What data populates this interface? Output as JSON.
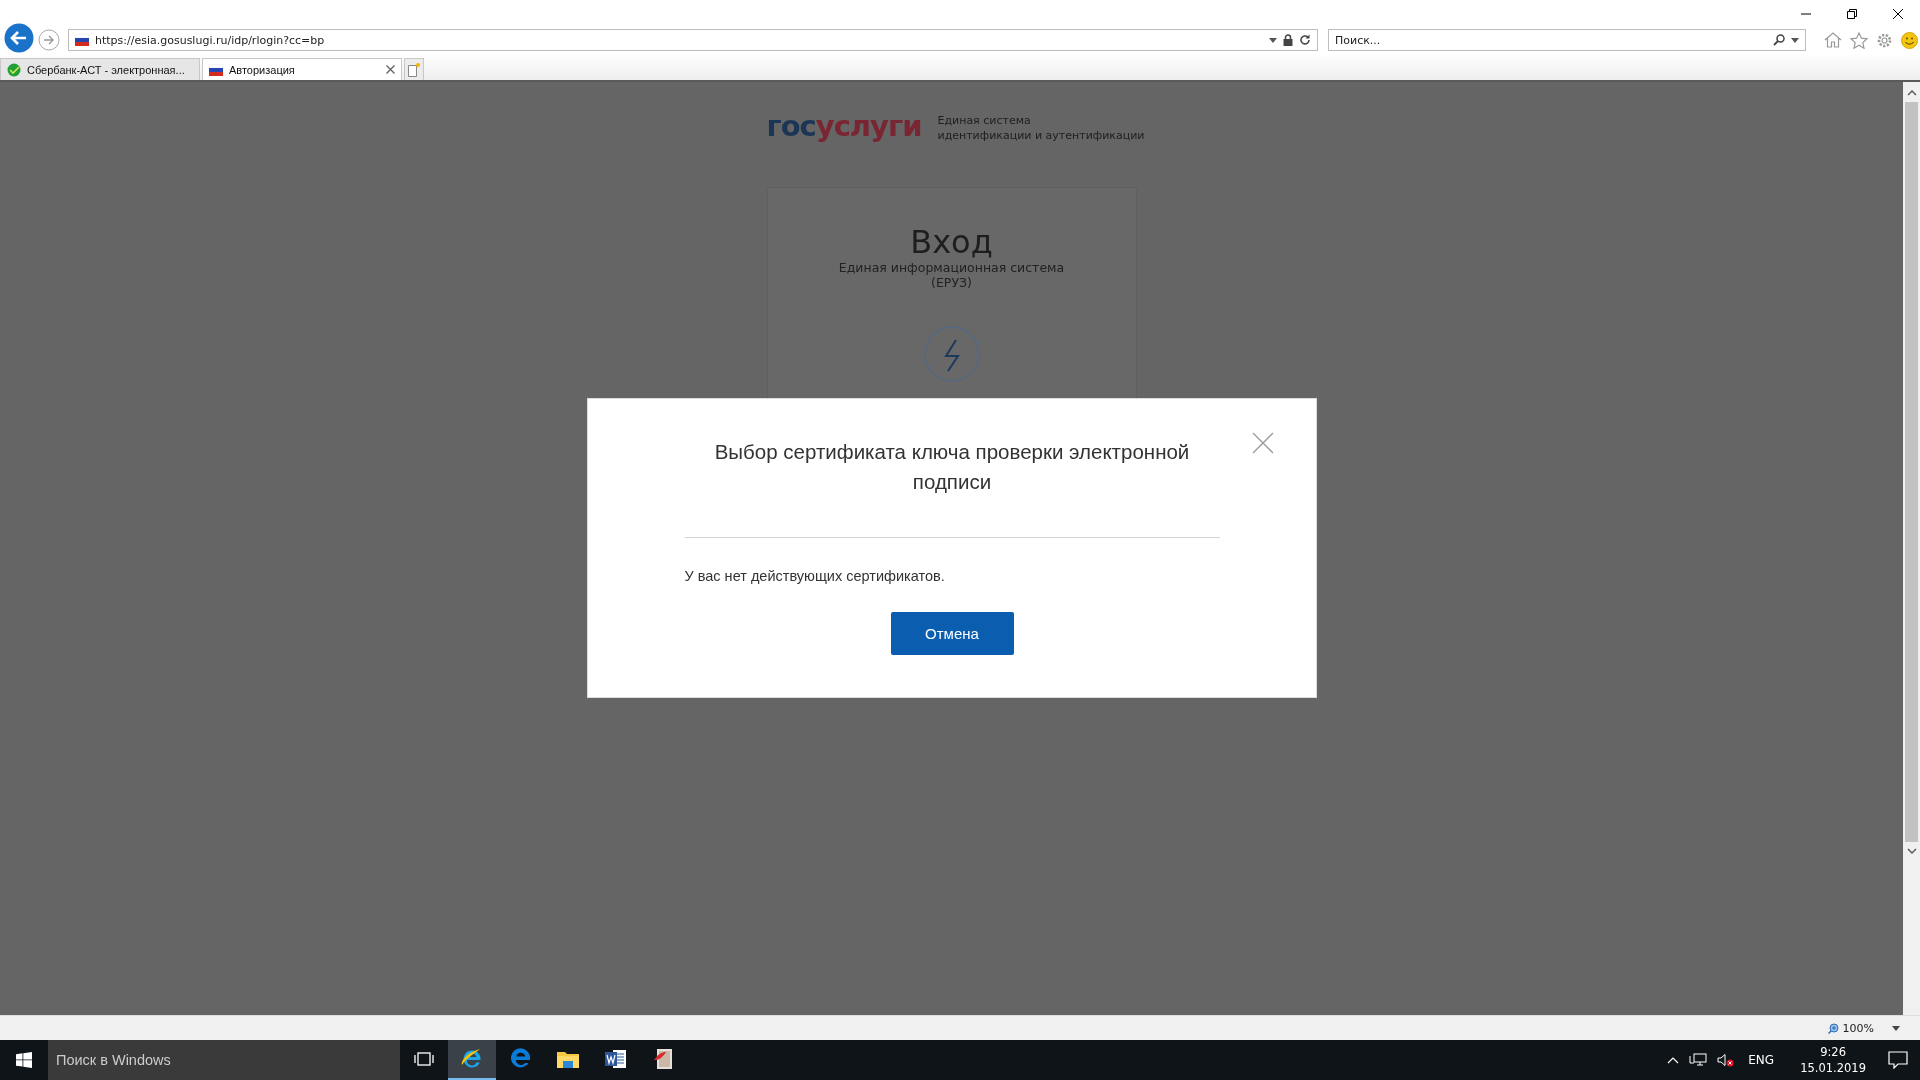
{
  "browser": {
    "url": "https://esia.gosuslugi.ru/idp/rlogin?cc=bp",
    "search_placeholder": "Поиск...",
    "tabs": [
      {
        "title": "Сбербанк-АСТ - электронная...",
        "kind": "sber",
        "selected": false
      },
      {
        "title": "Авторизация",
        "kind": "flag",
        "selected": true
      }
    ],
    "zoom": "100%"
  },
  "page": {
    "logo": {
      "part_1": "гос",
      "part_2": "услуги"
    },
    "system_name": [
      "Единая система",
      "идентификации и аутентификации"
    ],
    "card": {
      "title": "Вход",
      "subtitle": [
        "Единая информационная система",
        "(ЕРУЗ)"
      ]
    }
  },
  "dialog": {
    "title": "Выбор сертификата ключа проверки электронной подписи",
    "message": "У вас нет действующих сертификатов.",
    "button": "Отмена"
  },
  "taskbar": {
    "search_placeholder": "Поиск в Windows",
    "apps": [
      {
        "kind": "ie",
        "selected": true
      },
      {
        "kind": "edge",
        "selected": false
      },
      {
        "kind": "folder",
        "selected": false
      },
      {
        "kind": "word",
        "selected": false
      },
      {
        "kind": "pdf",
        "selected": false
      }
    ],
    "language": "ENG",
    "time": "9:26",
    "date": "15.01.2019"
  }
}
